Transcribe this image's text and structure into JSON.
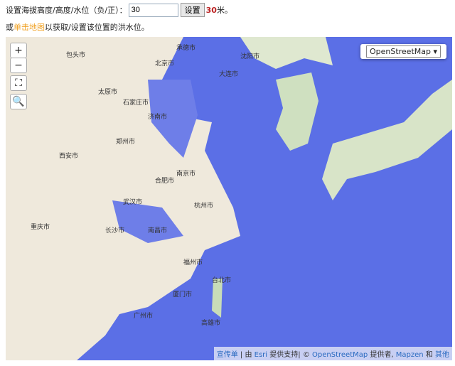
{
  "form": {
    "label": "设置海拔高度/高度/水位（负/正）：",
    "input_value": "30",
    "set_button": "设置",
    "current_value": "30",
    "unit": "米。"
  },
  "hint": {
    "prefix": "或",
    "link": "单击地图",
    "suffix": "以获取/设置该位置的洪水位。"
  },
  "map": {
    "zoom_in": "+",
    "zoom_out": "−",
    "layer_select": "OpenStreetMap ▾",
    "cities": [
      "包头市",
      "北京市",
      "承德市",
      "沈阳市",
      "太原市",
      "石家庄市",
      "济南市",
      "大连市",
      "西安市",
      "郑州市",
      "南京市",
      "合肥市",
      "武汉市",
      "长沙市",
      "南昌市",
      "杭州市",
      "福州市",
      "重庆市",
      "广州市",
      "台北市",
      "高雄市",
      "厦门市"
    ],
    "flood_color": "#5b6fe6"
  },
  "attribution": {
    "link1": "宣传单",
    "by": "| 由",
    "esri": "Esri",
    "support": "提供支持| ©",
    "osm": "OpenStreetMap",
    "provider": "提供者,",
    "mapzen": "Mapzen",
    "and": "和",
    "others": "其他"
  }
}
